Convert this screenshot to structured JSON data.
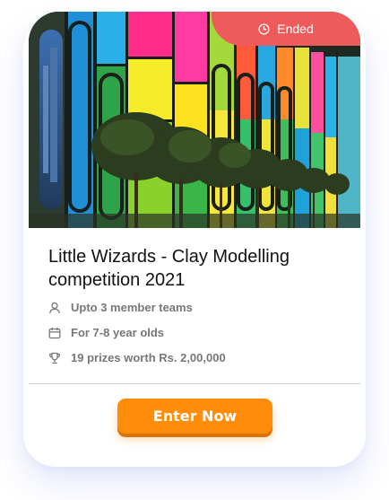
{
  "card": {
    "status": {
      "icon": "clock-icon",
      "label": "Ended",
      "color": "#ef5b5b"
    },
    "banner": {
      "description_icon": "stained-glass-photo"
    },
    "title": "Little Wizards - Clay Modelling competition 2021",
    "details": [
      {
        "icon": "user-icon",
        "text": "Upto 3 member teams"
      },
      {
        "icon": "calendar-icon",
        "text": "For 7-8 year olds"
      },
      {
        "icon": "trophy-icon",
        "text": "19 prizes worth Rs. 2,00,000"
      }
    ],
    "cta": {
      "label": "Enter Now",
      "color": "#ff8d0a"
    }
  }
}
